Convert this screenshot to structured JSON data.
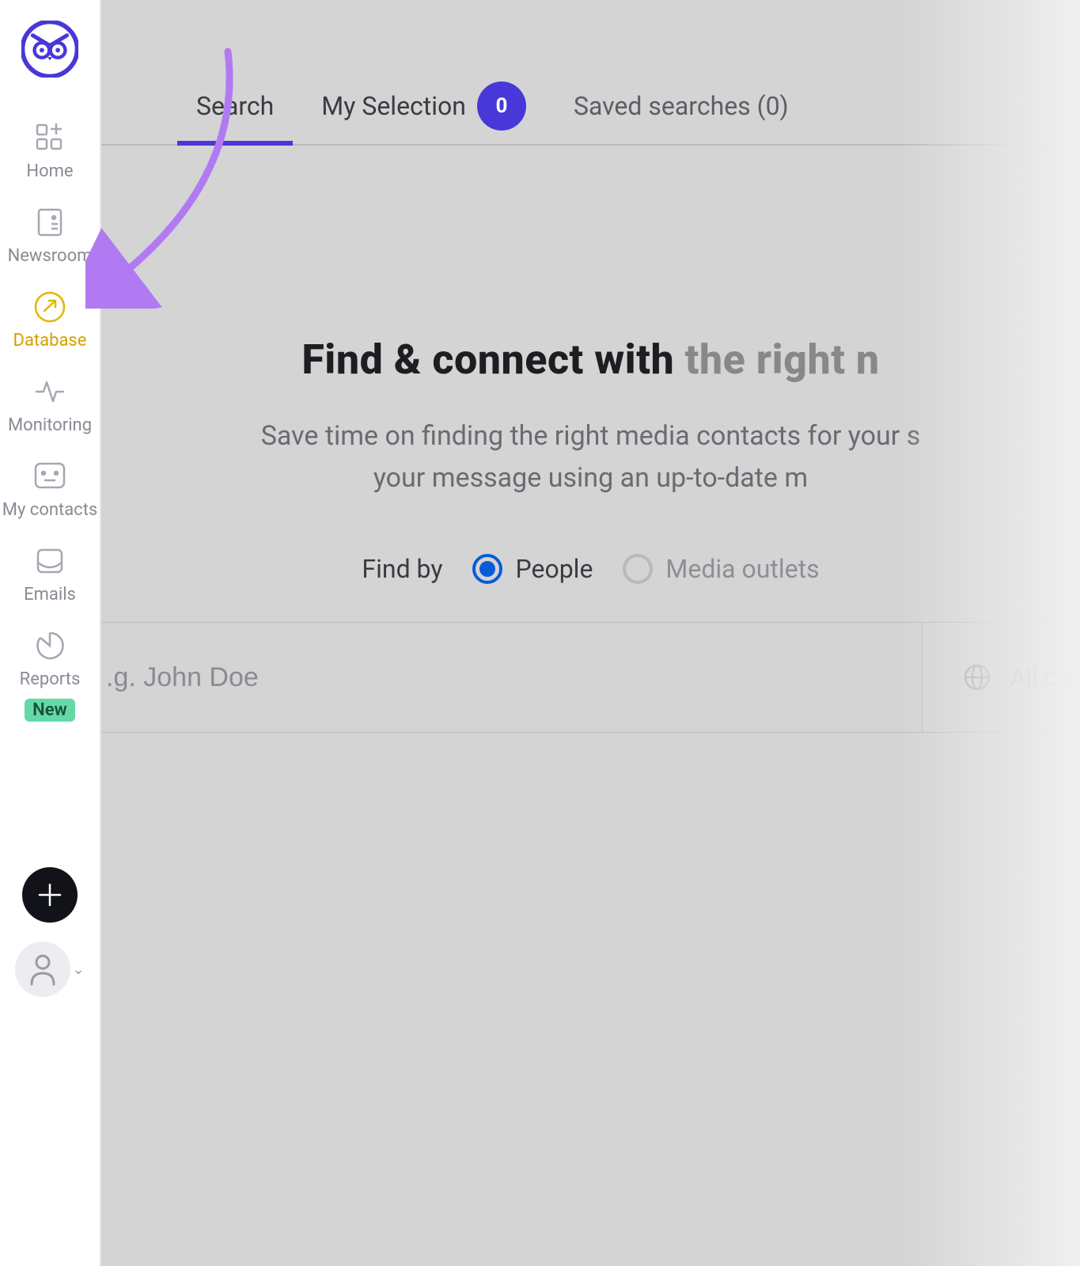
{
  "sidebar": {
    "items": [
      {
        "label": "Home"
      },
      {
        "label": "Newsroom"
      },
      {
        "label": "Database"
      },
      {
        "label": "Monitoring"
      },
      {
        "label": "My contacts"
      },
      {
        "label": "Emails"
      },
      {
        "label": "Reports",
        "badge": "New"
      }
    ]
  },
  "tabs": {
    "search": "Search",
    "my_selection": "My Selection",
    "my_selection_count": "0",
    "saved": "Saved searches (0)"
  },
  "hero": {
    "title_a": "Find & connect with",
    "title_b": " the right n",
    "sub_line1": "Save time on finding the right media contacts for your s",
    "sub_line2": "your message using an up-to-date m"
  },
  "findby": {
    "label": "Find by",
    "option_people": "People",
    "option_outlets": "Media outlets"
  },
  "search": {
    "placeholder": ".g. John Doe",
    "country_label": "All co"
  },
  "colors": {
    "brand": "#4838d8",
    "accent_yellow": "#d5a000",
    "badge_green": "#63d9a8"
  }
}
